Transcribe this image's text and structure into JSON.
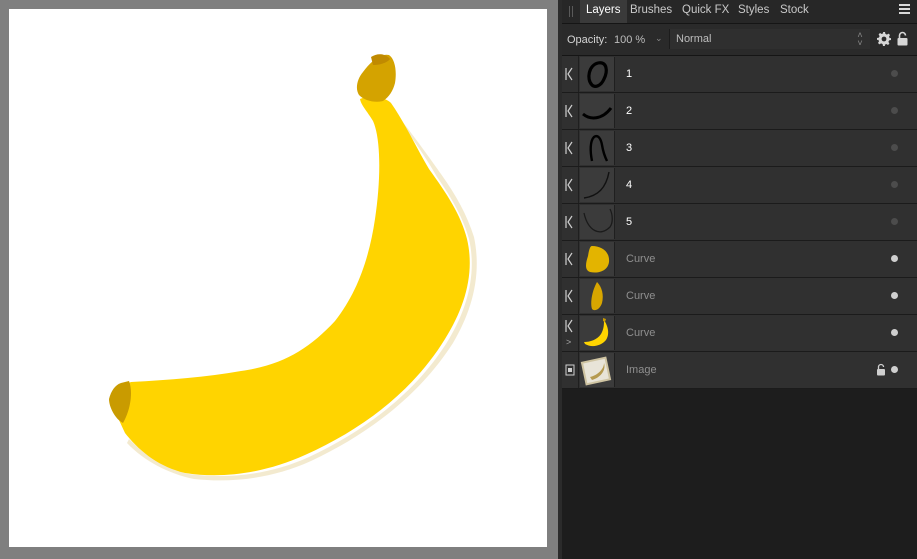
{
  "tabs": [
    {
      "label": "Layers",
      "active": true
    },
    {
      "label": "Brushes",
      "active": false
    },
    {
      "label": "Quick FX",
      "active": false
    },
    {
      "label": "Styles",
      "active": false
    },
    {
      "label": "Stock",
      "active": false
    }
  ],
  "options": {
    "opacity_label": "Opacity:",
    "opacity_value": "100 %",
    "blend_mode": "Normal"
  },
  "layers": [
    {
      "name": "1",
      "thumbnail": "stroke-loop",
      "visible": false,
      "expander": ""
    },
    {
      "name": "2",
      "thumbnail": "stroke-smile",
      "visible": false,
      "expander": ""
    },
    {
      "name": "3",
      "thumbnail": "stroke-hook",
      "visible": false,
      "expander": ""
    },
    {
      "name": "4",
      "thumbnail": "stroke-curve",
      "visible": false,
      "expander": ""
    },
    {
      "name": "5",
      "thumbnail": "stroke-arc",
      "visible": false,
      "expander": ""
    },
    {
      "name": "Curve",
      "thumbnail": "yellow-tip",
      "visible": true,
      "expander": ""
    },
    {
      "name": "Curve",
      "thumbnail": "yellow-sliver",
      "visible": true,
      "expander": ""
    },
    {
      "name": "Curve",
      "thumbnail": "banana",
      "visible": true,
      "expander": ">"
    },
    {
      "name": "Image",
      "thumbnail": "photo",
      "visible": true,
      "expander": "",
      "locked": true
    }
  ],
  "colors": {
    "banana_yellow": "#FFD400",
    "banana_tip": "#D4A300",
    "panel_bg": "#1D1D1D",
    "row_bg": "#303030"
  }
}
